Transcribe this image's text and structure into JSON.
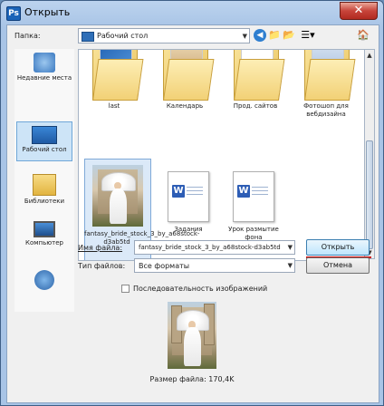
{
  "window": {
    "title": "Открыть",
    "close_label": "✕"
  },
  "toolbar": {
    "folder_label": "Папка:",
    "folder_value": "Рабочий стол",
    "icons": [
      "back-icon",
      "up-folder-icon",
      "new-folder-icon",
      "views-menu-icon"
    ]
  },
  "places": [
    {
      "label": "Недавние места",
      "icon": "recent-places-icon"
    },
    {
      "label": "Рабочий стол",
      "icon": "desktop-icon",
      "selected": true
    },
    {
      "label": "Библиотеки",
      "icon": "libraries-icon"
    },
    {
      "label": "Компьютер",
      "icon": "computer-icon"
    },
    {
      "label": "",
      "icon": "network-icon"
    }
  ],
  "files": [
    {
      "name": "last",
      "type": "folder"
    },
    {
      "name": "Календарь",
      "type": "folder"
    },
    {
      "name": "Прод. сайтов",
      "type": "folder"
    },
    {
      "name": "Фотошоп для вебдизайна",
      "type": "folder"
    },
    {
      "name": "fantasy_bride_stock_3_by_a68stock-d3ab5td",
      "type": "image",
      "selected": true
    },
    {
      "name": "Задания",
      "type": "word"
    },
    {
      "name": "Урок размытие фона",
      "type": "word"
    }
  ],
  "form": {
    "filename_label": "Имя файла:",
    "filename_value": "fantasy_bride_stock_3_by_a68stock-d3ab5td",
    "filetype_label": "Тип файлов:",
    "filetype_value": "Все форматы",
    "open_button": "Открыть",
    "cancel_button": "Отмена"
  },
  "preview": {
    "checkbox_label": "Последовательность изображений",
    "checked": false,
    "file_size": "Размер файла: 170,4K"
  },
  "colors": {
    "highlight": "#d01010",
    "selection": "#cde4f7"
  }
}
